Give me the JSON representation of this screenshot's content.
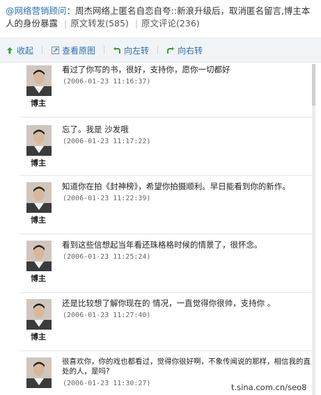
{
  "post": {
    "author": "@网络营销顾问",
    "colon": "：",
    "text": "周杰网络上匿名自恋自夸::新浪升级后，取消匿名留言,博主本人的身份暴露",
    "repost_label": "原文转发(585)",
    "comment_label": "原文评论(236)"
  },
  "toolbar": {
    "collapse": "收起",
    "view_original": "查看原图",
    "rotate_left": "向左转",
    "rotate_right": "向右转"
  },
  "comments": [
    {
      "role": "博主",
      "text": "看过了你写的书，很好，支持你，愿你一切都好",
      "time": "(2006-01-23 11:16:37)"
    },
    {
      "role": "博主",
      "text": "忘了。我是 沙发哦",
      "time": "(2006-01-23 11:17:22)"
    },
    {
      "role": "博主",
      "text": "知道你在拍《封神榜》，希望你拍摄顺利。早日能看到你的新作。",
      "time": "(2006-01-23 11:22:39)"
    },
    {
      "role": "博主",
      "text": "看到这些信想起当年看还珠格格时候的情景了，很怀念。",
      "time": "(2006-01-23 11:25:24)"
    },
    {
      "role": "博主",
      "text": "还是比较想了解你现在的 情况，一直觉得你很帅，支持你 。",
      "time": "(2006-01-23 11:27:40)"
    },
    {
      "role": "博主",
      "text": "很喜欢你，你的戏也都看过，觉得你很好啊，不象传闻说的那样，相信我的直",
      "text2": "处的人，是吗?",
      "time": "(2006-01-23 11:30:27)"
    }
  ],
  "watermark": "t.sina.com.cn/seo8",
  "colors": {
    "link": "#2a6fb0",
    "toolbar_bg": "#f1f4f7",
    "icon_green": "#3a9a3a"
  }
}
